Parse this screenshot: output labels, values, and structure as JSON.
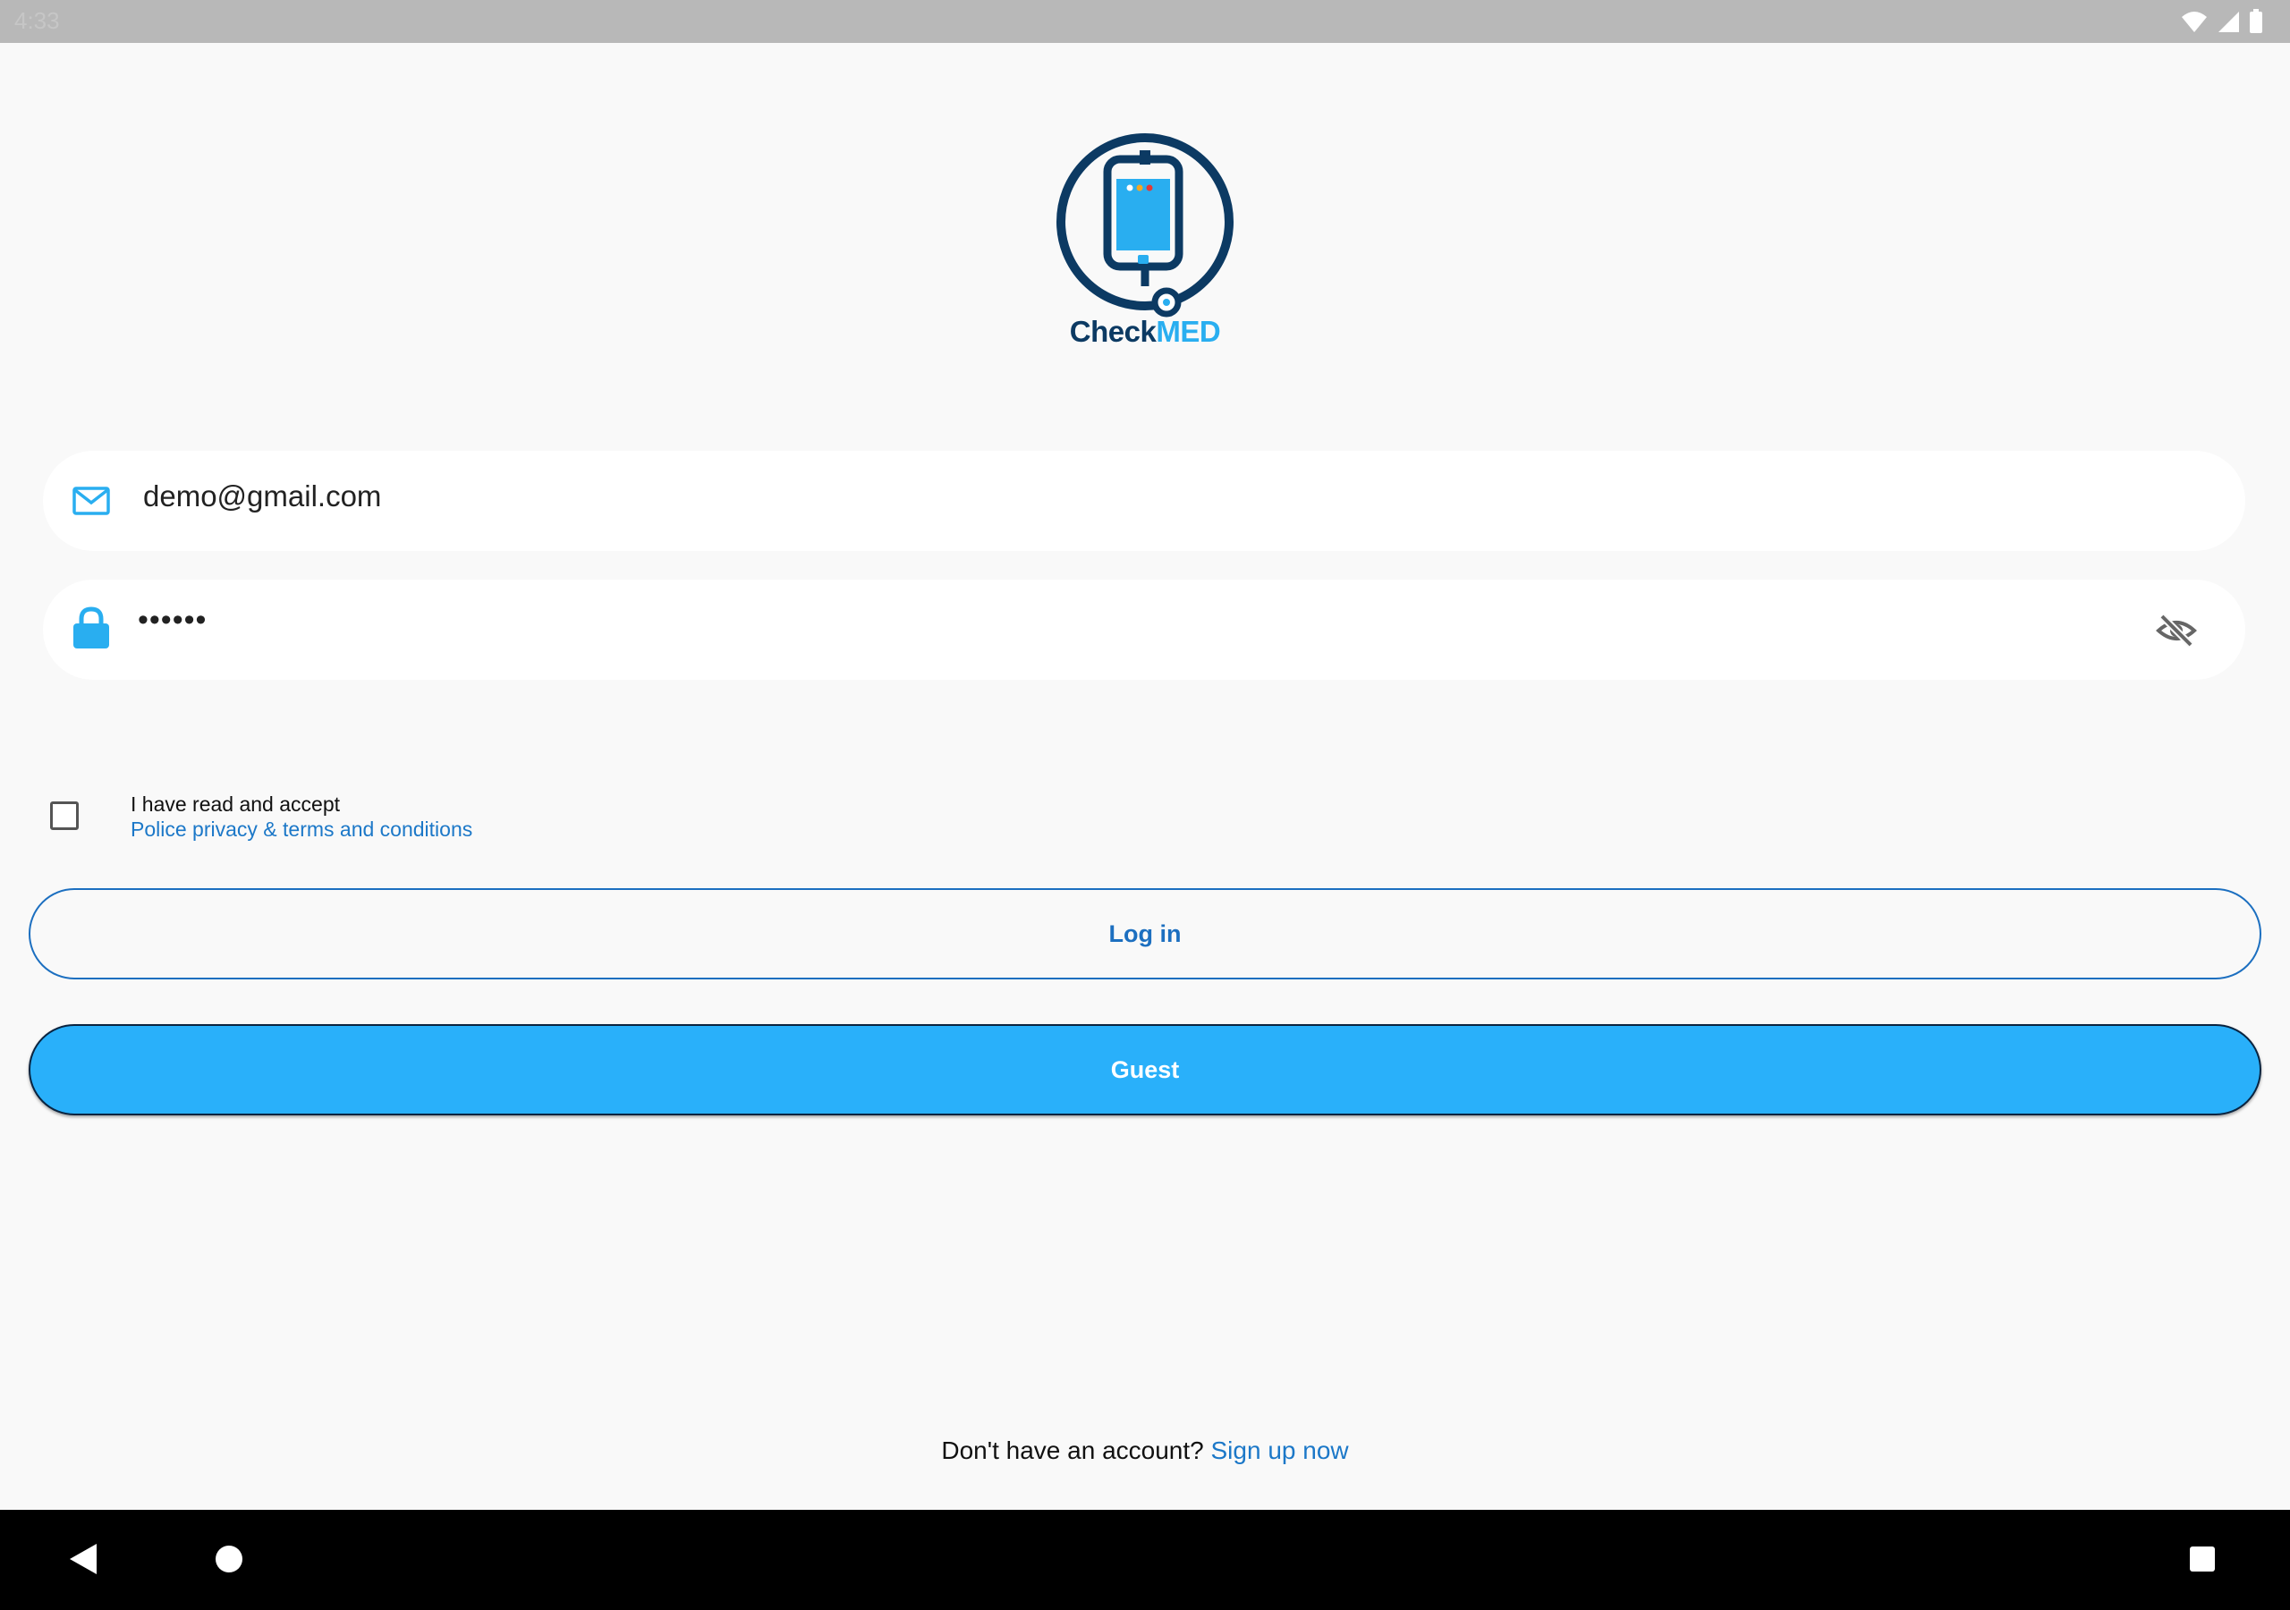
{
  "status_bar": {
    "time": "4:33",
    "icons": [
      "wifi-icon",
      "signal-icon",
      "battery-icon"
    ]
  },
  "logo": {
    "text_part1": "Check",
    "text_part2": "MED",
    "colors": {
      "dark": "#0c3a63",
      "light": "#29aef0"
    }
  },
  "form": {
    "email": {
      "value": "demo@gmail.com",
      "icon": "mail-icon"
    },
    "password": {
      "value": "••••••",
      "icon": "lock-icon",
      "toggle_icon": "eye-off-icon"
    }
  },
  "terms": {
    "checked": false,
    "text": "I have read and accept",
    "link": "Police privacy & terms and conditions"
  },
  "buttons": {
    "login": "Log in",
    "guest": "Guest"
  },
  "signup": {
    "prompt": "Don't have an account?",
    "link": "Sign up now"
  },
  "nav_bar": {
    "icons": [
      "back-icon",
      "home-icon",
      "recents-icon"
    ]
  },
  "colors": {
    "accent": "#29b0fa",
    "link": "#1c78c8",
    "background": "#f9f9f9"
  }
}
